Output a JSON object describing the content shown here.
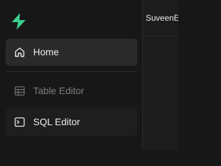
{
  "brand": {
    "logo_icon": "supabase-bolt-icon",
    "accent": "#3ecf8e"
  },
  "header": {
    "org_name": "SuveenE"
  },
  "sidebar": {
    "items": [
      {
        "label": "Home",
        "icon": "home-icon",
        "state": "active"
      },
      {
        "label": "Table Editor",
        "icon": "table-icon",
        "state": "muted"
      },
      {
        "label": "SQL Editor",
        "icon": "terminal-icon",
        "state": "normal"
      }
    ]
  }
}
